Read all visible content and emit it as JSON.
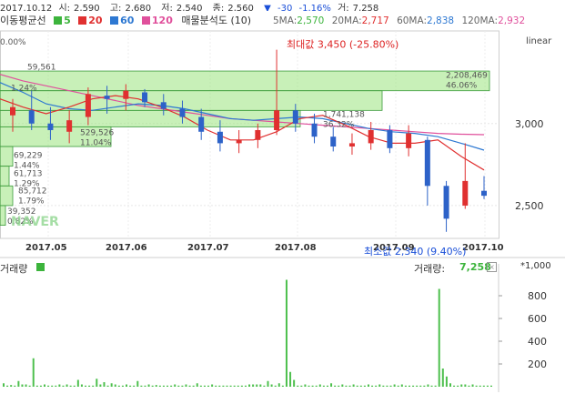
{
  "header": {
    "date": "2017.10.12",
    "open_label": "시:",
    "open": "2,590",
    "high_label": "고:",
    "high": "2,680",
    "low_label": "저:",
    "low": "2,540",
    "close_label": "종:",
    "close": "2,560",
    "change": "-30",
    "change_pct": "-1.16%",
    "volume_label": "거:",
    "volume": "7,258",
    "down_arrow": "▼"
  },
  "legend": {
    "title": "이동평균선",
    "ma5": "5",
    "ma20": "20",
    "ma60": "60",
    "ma120": "120",
    "volume_profile": "매물분석도 (10)",
    "colors": {
      "ma5": "#3cb43c",
      "ma20": "#e03030",
      "ma60": "#2d78d2",
      "ma120": "#e0509c"
    }
  },
  "ma_values": {
    "ma5_label": "5MA:",
    "ma5": "2,570",
    "ma20_label": "20MA:",
    "ma20": "2,717",
    "ma60_label": "60MA:",
    "ma60": "2,838",
    "ma120_label": "120MA:",
    "ma120": "2,932"
  },
  "scale": {
    "mode": "linear",
    "y_ticks": [
      "3,000",
      "2,500"
    ],
    "vol_ticks": [
      "800",
      "600",
      "400",
      "200"
    ],
    "vol_unit": "*1,000"
  },
  "annotations": {
    "max_label": "최대값 3,450 (-25.80%)",
    "min_label": "최소값 2,340 (9.40%)",
    "watermark": "NAVER",
    "left_pct_top": "0.00%"
  },
  "volume_header": {
    "title": "거래량",
    "label": "거래량:",
    "value": "7,258"
  },
  "chart_data": {
    "type": "candlestick",
    "x_labels": [
      "2017.05",
      "2017.06",
      "2017.07",
      "2017.08",
      "2017.09",
      "2017.10"
    ],
    "ylim": [
      2300,
      3520
    ],
    "volume_ylim": [
      0,
      1000
    ],
    "candles_weekly_approx": [
      {
        "o": 3050,
        "h": 3150,
        "l": 2950,
        "c": 3100
      },
      {
        "o": 3080,
        "h": 3200,
        "l": 2960,
        "c": 3000
      },
      {
        "o": 3000,
        "h": 3100,
        "l": 2900,
        "c": 2960
      },
      {
        "o": 2950,
        "h": 3080,
        "l": 2880,
        "c": 3020
      },
      {
        "o": 3040,
        "h": 3220,
        "l": 2990,
        "c": 3180
      },
      {
        "o": 3170,
        "h": 3230,
        "l": 3060,
        "c": 3150
      },
      {
        "o": 3150,
        "h": 3240,
        "l": 3080,
        "c": 3200
      },
      {
        "o": 3190,
        "h": 3210,
        "l": 3100,
        "c": 3130
      },
      {
        "o": 3130,
        "h": 3180,
        "l": 3050,
        "c": 3090
      },
      {
        "o": 3090,
        "h": 3140,
        "l": 3000,
        "c": 3040
      },
      {
        "o": 3040,
        "h": 3090,
        "l": 2900,
        "c": 2950
      },
      {
        "o": 2950,
        "h": 3020,
        "l": 2830,
        "c": 2880
      },
      {
        "o": 2880,
        "h": 2960,
        "l": 2820,
        "c": 2900
      },
      {
        "o": 2900,
        "h": 3000,
        "l": 2850,
        "c": 2960
      },
      {
        "o": 2960,
        "h": 3450,
        "l": 2930,
        "c": 3080
      },
      {
        "o": 3080,
        "h": 3120,
        "l": 2950,
        "c": 3000
      },
      {
        "o": 3000,
        "h": 3060,
        "l": 2880,
        "c": 2920
      },
      {
        "o": 2920,
        "h": 2980,
        "l": 2830,
        "c": 2860
      },
      {
        "o": 2860,
        "h": 2940,
        "l": 2810,
        "c": 2880
      },
      {
        "o": 2880,
        "h": 3010,
        "l": 2840,
        "c": 2960
      },
      {
        "o": 2960,
        "h": 2990,
        "l": 2820,
        "c": 2850
      },
      {
        "o": 2850,
        "h": 2990,
        "l": 2800,
        "c": 2940
      },
      {
        "o": 2900,
        "h": 2920,
        "l": 2500,
        "c": 2620
      },
      {
        "o": 2620,
        "h": 2650,
        "l": 2340,
        "c": 2420
      },
      {
        "o": 2500,
        "h": 2880,
        "l": 2480,
        "c": 2650
      },
      {
        "o": 2590,
        "h": 2680,
        "l": 2540,
        "c": 2560
      }
    ],
    "ma120": [
      3300,
      3260,
      3230,
      3200,
      3170,
      3140,
      3110,
      3090,
      3070,
      3050,
      3030,
      3020,
      3010,
      3000,
      2990,
      2980,
      2970,
      2960,
      2950,
      2940,
      2935,
      2932
    ],
    "ma60": [
      3250,
      3190,
      3120,
      3090,
      3080,
      3100,
      3120,
      3110,
      3090,
      3060,
      3030,
      3020,
      3030,
      3040,
      3030,
      3000,
      2970,
      2950,
      2940,
      2920,
      2880,
      2838
    ],
    "ma20": [
      3150,
      3100,
      3060,
      3100,
      3150,
      3170,
      3150,
      3100,
      3040,
      2960,
      2900,
      2900,
      2950,
      3030,
      3050,
      2990,
      2920,
      2880,
      2880,
      2900,
      2800,
      2717
    ],
    "volume_profile": [
      {
        "price_from": 3200,
        "price_to": 3320,
        "volume": "2,208,469",
        "pct": "46.06%"
      },
      {
        "price_from": 3080,
        "price_to": 3200,
        "volume": "",
        "pct": ""
      },
      {
        "price_from": 2980,
        "price_to": 3080,
        "volume": "1,741,138",
        "pct": "36.32%"
      },
      {
        "price_from": 2860,
        "price_to": 2980,
        "volume": "529,526",
        "pct": "11.04%"
      },
      {
        "price_from": 2740,
        "price_to": 2860,
        "volume": "69,229",
        "pct": "1.44%"
      },
      {
        "price_from": 2620,
        "price_to": 2740,
        "volume": "61,713",
        "pct": "1.29%"
      },
      {
        "price_from": 2500,
        "price_to": 2620,
        "volume": "85,712",
        "pct": "1.79%"
      },
      {
        "price_from": 2380,
        "price_to": 2500,
        "volume": "39,352",
        "pct": "0.82%"
      }
    ],
    "left_profile_top": {
      "volume": "59,561",
      "pct": "1.24%"
    },
    "volumes": [
      30,
      10,
      15,
      10,
      50,
      20,
      20,
      10,
      250,
      10,
      10,
      20,
      10,
      10,
      10,
      20,
      10,
      20,
      10,
      10,
      60,
      20,
      10,
      10,
      10,
      70,
      20,
      40,
      10,
      30,
      20,
      10,
      10,
      20,
      10,
      10,
      50,
      10,
      10,
      20,
      10,
      15,
      10,
      10,
      10,
      10,
      20,
      10,
      10,
      20,
      10,
      10,
      30,
      10,
      10,
      10,
      20,
      10,
      10,
      10,
      10,
      10,
      10,
      10,
      10,
      10,
      20,
      20,
      20,
      20,
      10,
      50,
      20,
      10,
      30,
      10,
      940,
      130,
      60,
      10,
      10,
      20,
      10,
      10,
      10,
      20,
      10,
      10,
      30,
      10,
      10,
      20,
      10,
      10,
      20,
      10,
      10,
      10,
      20,
      10,
      10,
      20,
      10,
      10,
      10,
      20,
      10,
      20,
      10,
      10,
      10,
      10,
      10,
      10,
      20,
      10,
      10,
      860,
      160,
      90,
      30,
      10,
      10,
      20,
      20,
      10,
      20,
      10,
      10,
      10,
      10,
      10
    ]
  }
}
